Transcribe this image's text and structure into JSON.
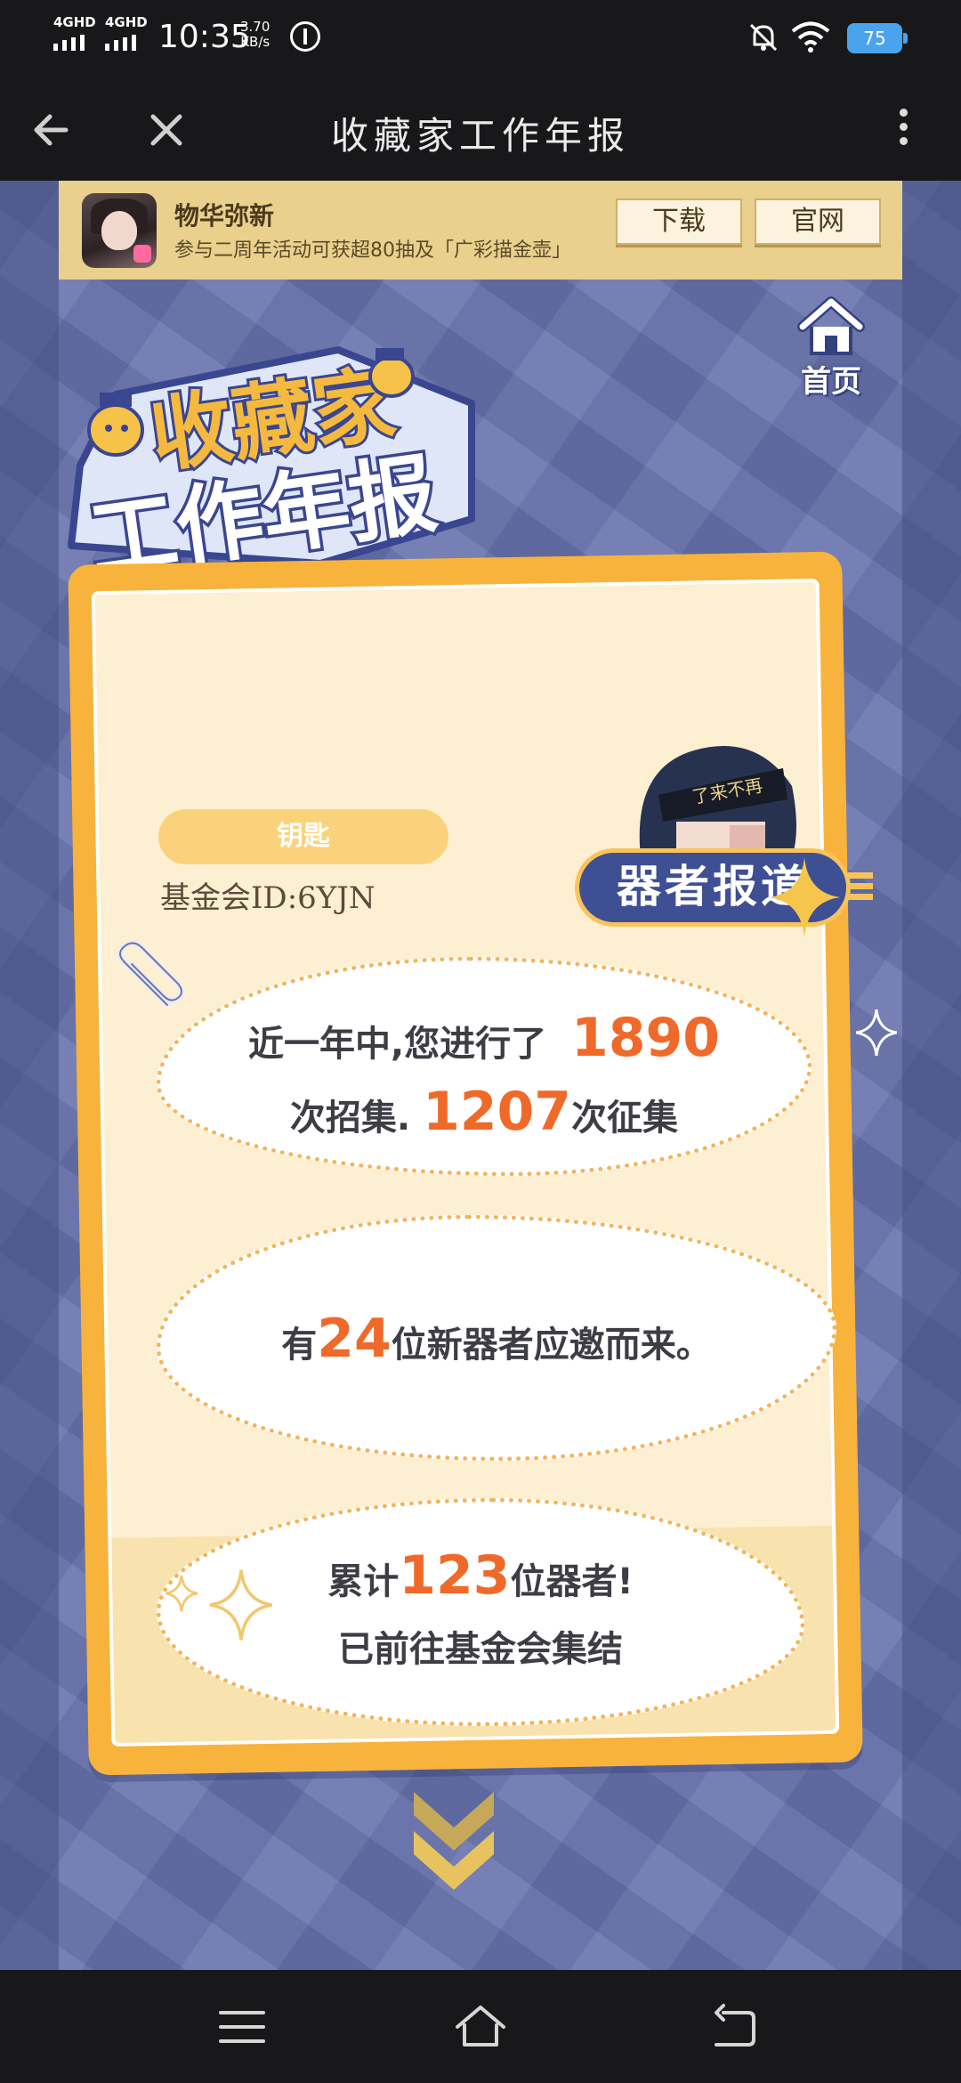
{
  "status_bar": {
    "sim1_label": "4GHD",
    "sim2_label": "4GHD",
    "time": "10:35",
    "net_speed_value": "3.70",
    "net_speed_unit": "KB/s",
    "battery_label": "75"
  },
  "browser_header": {
    "title": "收藏家工作年报",
    "back_icon": "back-arrow-icon",
    "close_icon": "close-icon",
    "more_icon": "more-vertical-icon"
  },
  "promo_banner": {
    "app_name": "物华弥新",
    "description": "参与二周年活动可获超80抽及「广彩描金壶」",
    "download_label": "下载",
    "official_site_label": "官网"
  },
  "page": {
    "home_label": "首页",
    "title_line1": "收藏家",
    "title_line2": "工作年报",
    "rank_badge": "钥匙",
    "foundation_id": "基金会ID:6YJN",
    "reporter_tag": "器者报道",
    "character_headband": "了来不再",
    "stats": {
      "line1_prefix": "近一年中,您进行了",
      "recruit_count": "1890",
      "line2_prefix": "次招集.",
      "collect_count": "1207",
      "line2_suffix": "次征集",
      "new_prefix": "有",
      "new_count": "24",
      "new_suffix": "位新器者应邀而来。",
      "total_prefix": "累计",
      "total_count": "123",
      "total_suffix": "位器者!",
      "gather_line": "已前往基金会集结"
    }
  },
  "nav_bar": {
    "menu_icon": "menu-icon",
    "home_icon": "home-outline-icon",
    "back_icon": "return-icon"
  },
  "colors": {
    "accent_orange": "#ef6a2a",
    "card_gold": "#f8b33c",
    "tag_blue": "#3f4f93",
    "page_background": "#6a75ae"
  }
}
